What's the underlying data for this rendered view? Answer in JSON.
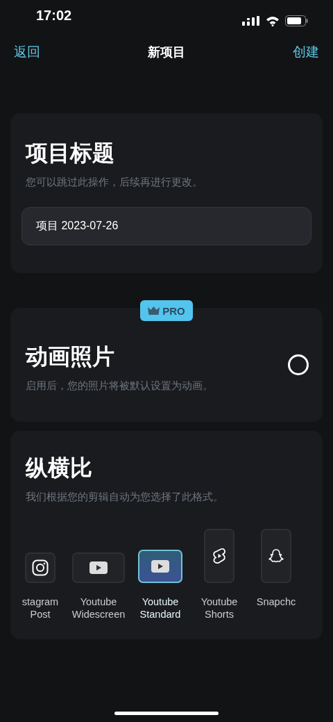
{
  "status_bar": {
    "time": "17:02"
  },
  "nav": {
    "back": "返回",
    "title": "新项目",
    "action": "创建"
  },
  "title_card": {
    "heading": "项目标题",
    "hint": "您可以跳过此操作，后续再进行更改。",
    "field_value": "项目 2023-07-26"
  },
  "animation_card": {
    "badge": "PRO",
    "heading": "动画照片",
    "hint": "启用后，您的照片将被默认设置为动画。",
    "on": false
  },
  "aspect_card": {
    "heading": "纵横比",
    "hint": "我们根据您的剪辑自动为您选择了此格式。",
    "formats": [
      {
        "label": "stagram\nPost",
        "kind": "square",
        "selected": false
      },
      {
        "label": "Youtube\nWidescreen",
        "kind": "wide",
        "selected": false
      },
      {
        "label": "Youtube\nStandard",
        "kind": "standard",
        "selected": true
      },
      {
        "label": "Youtube\nShorts",
        "kind": "tall",
        "selected": false
      },
      {
        "label": "Snapchc",
        "kind": "tall",
        "selected": false
      }
    ]
  }
}
